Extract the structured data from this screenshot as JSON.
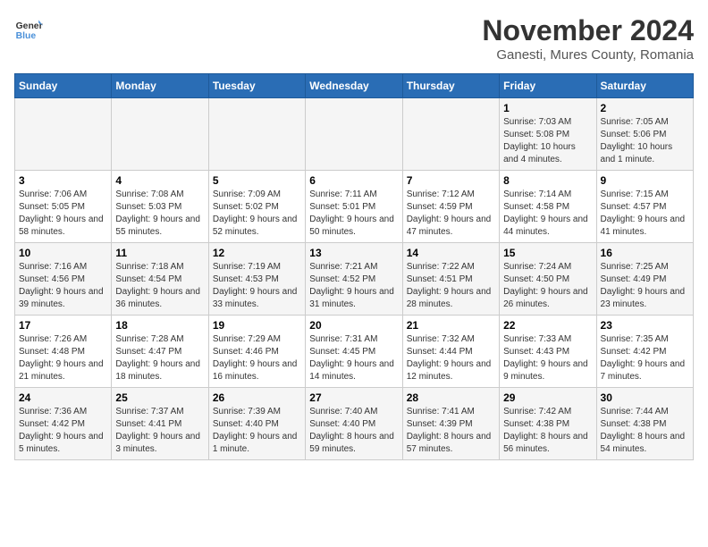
{
  "header": {
    "logo_line1": "General",
    "logo_line2": "Blue",
    "month": "November 2024",
    "location": "Ganesti, Mures County, Romania"
  },
  "weekdays": [
    "Sunday",
    "Monday",
    "Tuesday",
    "Wednesday",
    "Thursday",
    "Friday",
    "Saturday"
  ],
  "weeks": [
    [
      {
        "day": "",
        "info": ""
      },
      {
        "day": "",
        "info": ""
      },
      {
        "day": "",
        "info": ""
      },
      {
        "day": "",
        "info": ""
      },
      {
        "day": "",
        "info": ""
      },
      {
        "day": "1",
        "info": "Sunrise: 7:03 AM\nSunset: 5:08 PM\nDaylight: 10 hours and 4 minutes."
      },
      {
        "day": "2",
        "info": "Sunrise: 7:05 AM\nSunset: 5:06 PM\nDaylight: 10 hours and 1 minute."
      }
    ],
    [
      {
        "day": "3",
        "info": "Sunrise: 7:06 AM\nSunset: 5:05 PM\nDaylight: 9 hours and 58 minutes."
      },
      {
        "day": "4",
        "info": "Sunrise: 7:08 AM\nSunset: 5:03 PM\nDaylight: 9 hours and 55 minutes."
      },
      {
        "day": "5",
        "info": "Sunrise: 7:09 AM\nSunset: 5:02 PM\nDaylight: 9 hours and 52 minutes."
      },
      {
        "day": "6",
        "info": "Sunrise: 7:11 AM\nSunset: 5:01 PM\nDaylight: 9 hours and 50 minutes."
      },
      {
        "day": "7",
        "info": "Sunrise: 7:12 AM\nSunset: 4:59 PM\nDaylight: 9 hours and 47 minutes."
      },
      {
        "day": "8",
        "info": "Sunrise: 7:14 AM\nSunset: 4:58 PM\nDaylight: 9 hours and 44 minutes."
      },
      {
        "day": "9",
        "info": "Sunrise: 7:15 AM\nSunset: 4:57 PM\nDaylight: 9 hours and 41 minutes."
      }
    ],
    [
      {
        "day": "10",
        "info": "Sunrise: 7:16 AM\nSunset: 4:56 PM\nDaylight: 9 hours and 39 minutes."
      },
      {
        "day": "11",
        "info": "Sunrise: 7:18 AM\nSunset: 4:54 PM\nDaylight: 9 hours and 36 minutes."
      },
      {
        "day": "12",
        "info": "Sunrise: 7:19 AM\nSunset: 4:53 PM\nDaylight: 9 hours and 33 minutes."
      },
      {
        "day": "13",
        "info": "Sunrise: 7:21 AM\nSunset: 4:52 PM\nDaylight: 9 hours and 31 minutes."
      },
      {
        "day": "14",
        "info": "Sunrise: 7:22 AM\nSunset: 4:51 PM\nDaylight: 9 hours and 28 minutes."
      },
      {
        "day": "15",
        "info": "Sunrise: 7:24 AM\nSunset: 4:50 PM\nDaylight: 9 hours and 26 minutes."
      },
      {
        "day": "16",
        "info": "Sunrise: 7:25 AM\nSunset: 4:49 PM\nDaylight: 9 hours and 23 minutes."
      }
    ],
    [
      {
        "day": "17",
        "info": "Sunrise: 7:26 AM\nSunset: 4:48 PM\nDaylight: 9 hours and 21 minutes."
      },
      {
        "day": "18",
        "info": "Sunrise: 7:28 AM\nSunset: 4:47 PM\nDaylight: 9 hours and 18 minutes."
      },
      {
        "day": "19",
        "info": "Sunrise: 7:29 AM\nSunset: 4:46 PM\nDaylight: 9 hours and 16 minutes."
      },
      {
        "day": "20",
        "info": "Sunrise: 7:31 AM\nSunset: 4:45 PM\nDaylight: 9 hours and 14 minutes."
      },
      {
        "day": "21",
        "info": "Sunrise: 7:32 AM\nSunset: 4:44 PM\nDaylight: 9 hours and 12 minutes."
      },
      {
        "day": "22",
        "info": "Sunrise: 7:33 AM\nSunset: 4:43 PM\nDaylight: 9 hours and 9 minutes."
      },
      {
        "day": "23",
        "info": "Sunrise: 7:35 AM\nSunset: 4:42 PM\nDaylight: 9 hours and 7 minutes."
      }
    ],
    [
      {
        "day": "24",
        "info": "Sunrise: 7:36 AM\nSunset: 4:42 PM\nDaylight: 9 hours and 5 minutes."
      },
      {
        "day": "25",
        "info": "Sunrise: 7:37 AM\nSunset: 4:41 PM\nDaylight: 9 hours and 3 minutes."
      },
      {
        "day": "26",
        "info": "Sunrise: 7:39 AM\nSunset: 4:40 PM\nDaylight: 9 hours and 1 minute."
      },
      {
        "day": "27",
        "info": "Sunrise: 7:40 AM\nSunset: 4:40 PM\nDaylight: 8 hours and 59 minutes."
      },
      {
        "day": "28",
        "info": "Sunrise: 7:41 AM\nSunset: 4:39 PM\nDaylight: 8 hours and 57 minutes."
      },
      {
        "day": "29",
        "info": "Sunrise: 7:42 AM\nSunset: 4:38 PM\nDaylight: 8 hours and 56 minutes."
      },
      {
        "day": "30",
        "info": "Sunrise: 7:44 AM\nSunset: 4:38 PM\nDaylight: 8 hours and 54 minutes."
      }
    ]
  ]
}
